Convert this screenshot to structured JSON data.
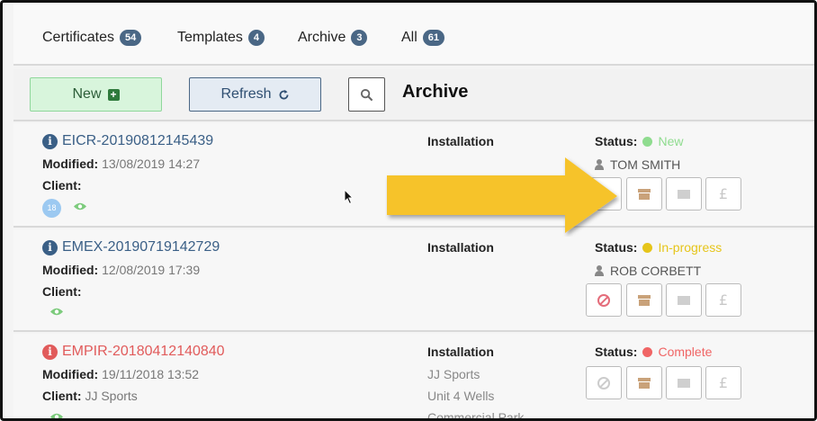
{
  "tabs": [
    {
      "label": "Certificates",
      "count": "54"
    },
    {
      "label": "Templates",
      "count": "4"
    },
    {
      "label": "Archive",
      "count": "3"
    },
    {
      "label": "All",
      "count": "61"
    }
  ],
  "toolbar": {
    "new_label": "New",
    "refresh_label": "Refresh",
    "title": "Archive"
  },
  "labels": {
    "modified": "Modified:",
    "client": "Client:",
    "installation": "Installation",
    "status": "Status:"
  },
  "rows": [
    {
      "id": "EICR-20190812145439",
      "modified": "13/08/2019 14:27",
      "client": "",
      "client_badge": "18",
      "installation_lines": [],
      "status": "New",
      "status_color": "#8fdc8f",
      "assignee": "TOM SMITH"
    },
    {
      "id": "EMEX-20190719142729",
      "modified": "12/08/2019 17:39",
      "client": "",
      "installation_lines": [],
      "status": "In-progress",
      "status_color": "#e6c51a",
      "assignee": "ROB CORBETT"
    },
    {
      "id": "EMPIR-20180412140840",
      "modified": "19/11/2018 13:52",
      "client": "JJ Sports",
      "installation_lines": [
        "JJ Sports",
        "Unit 4 Wells",
        "Commercial Park"
      ],
      "status": "Complete",
      "status_color": "#f06565"
    }
  ],
  "colors": {
    "accent": "#4a6785",
    "id_link": "#3a5f86",
    "id_link_error": "#e15b5b",
    "arrow": "#f6c32b"
  },
  "icons": [
    "info-icon",
    "eye-icon",
    "user-icon",
    "archive-box-icon",
    "envelope-icon",
    "pound-icon",
    "ban-icon",
    "search-icon",
    "refresh-icon",
    "plus-icon",
    "mouse-cursor",
    "highlight-arrow"
  ]
}
